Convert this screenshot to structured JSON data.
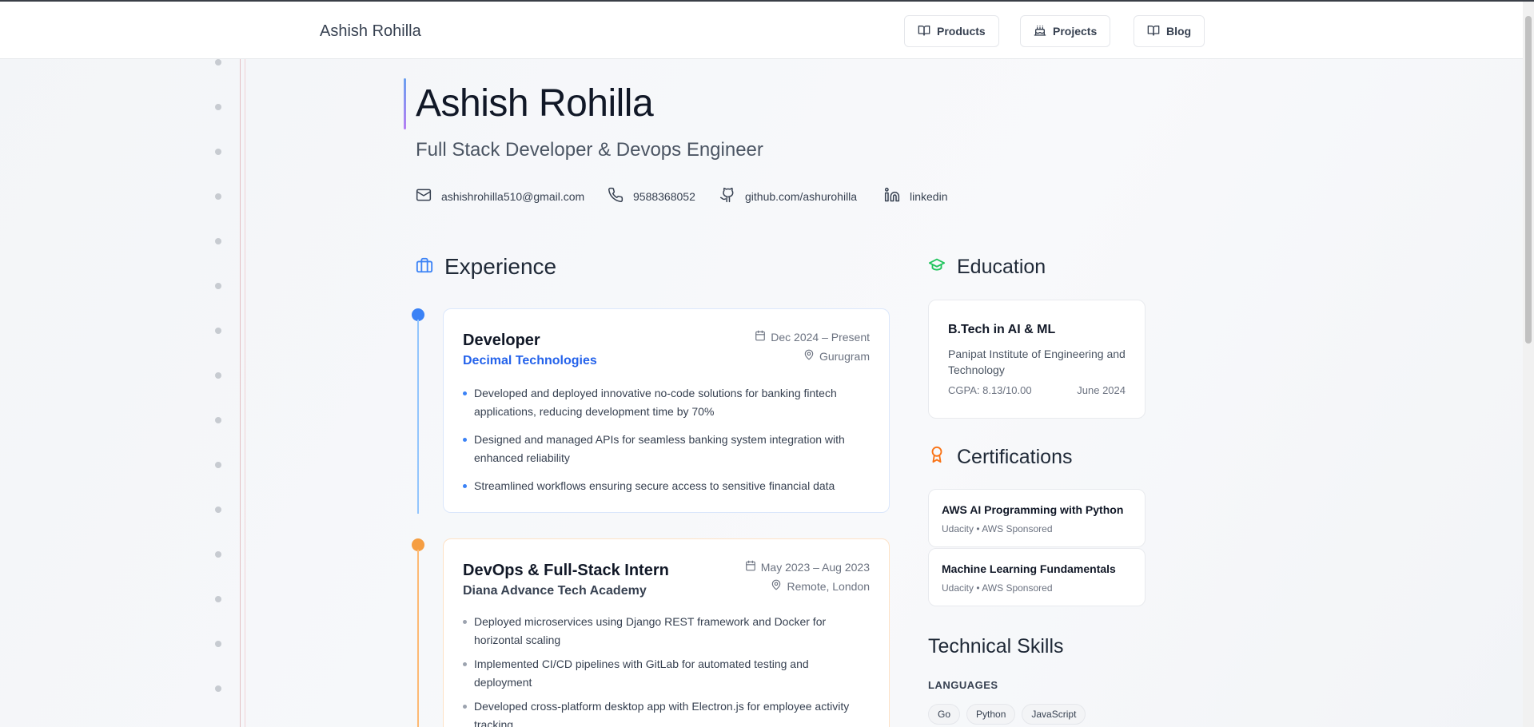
{
  "header": {
    "brand": "Ashish Rohilla",
    "nav": [
      {
        "label": "Products",
        "icon": "book-open-icon"
      },
      {
        "label": "Projects",
        "icon": "cake-icon"
      },
      {
        "label": "Blog",
        "icon": "book-open-icon"
      }
    ]
  },
  "hero": {
    "name": "Ashish Rohilla",
    "title": "Full Stack Developer & Devops Engineer"
  },
  "contacts": [
    {
      "icon": "mail-icon",
      "text": "ashishrohilla510@gmail.com"
    },
    {
      "icon": "phone-icon",
      "text": "9588368052"
    },
    {
      "icon": "github-icon",
      "text": "github.com/ashurohilla"
    },
    {
      "icon": "linkedin-icon",
      "text": "linkedin"
    }
  ],
  "experience": {
    "heading": "Experience",
    "items": [
      {
        "role": "Developer",
        "company": "Decimal Technologies",
        "dates": "Dec 2024 – Present",
        "location": "Gurugram",
        "accent": "#3b82f6",
        "bullets": [
          "Developed and deployed innovative no-code solutions for banking fintech applications, reducing development time by 70%",
          "Designed and managed APIs for seamless banking system integration with enhanced reliability",
          "Streamlined workflows ensuring secure access to sensitive financial data"
        ]
      },
      {
        "role": "DevOps & Full-Stack Intern",
        "company": "Diana Advance Tech Academy",
        "dates": "May 2023 – Aug 2023",
        "location": "Remote, London",
        "accent": "#f59e42",
        "bullets": [
          "Deployed microservices using Django REST framework and Docker for horizontal scaling",
          "Implemented CI/CD pipelines with GitLab for automated testing and deployment",
          "Developed cross-platform desktop app with Electron.js for employee activity tracking"
        ]
      }
    ]
  },
  "education": {
    "heading": "Education",
    "degree": "B.Tech in AI & ML",
    "school": "Panipat Institute of Engineering and Technology",
    "cgpa": "CGPA: 8.13/10.00",
    "date": "June 2024"
  },
  "certifications": {
    "heading": "Certifications",
    "items": [
      {
        "name": "AWS AI Programming with Python",
        "org": "Udacity • AWS Sponsored"
      },
      {
        "name": "Machine Learning Fundamentals",
        "org": "Udacity • AWS Sponsored"
      }
    ]
  },
  "skills": {
    "heading": "Technical Skills",
    "category": "LANGUAGES",
    "chips": [
      "Go",
      "Python",
      "JavaScript"
    ]
  },
  "colors": {
    "blue": "#3b82f6",
    "orange": "#f59e42",
    "green": "#22c55e",
    "company_blue": "#2563eb"
  }
}
